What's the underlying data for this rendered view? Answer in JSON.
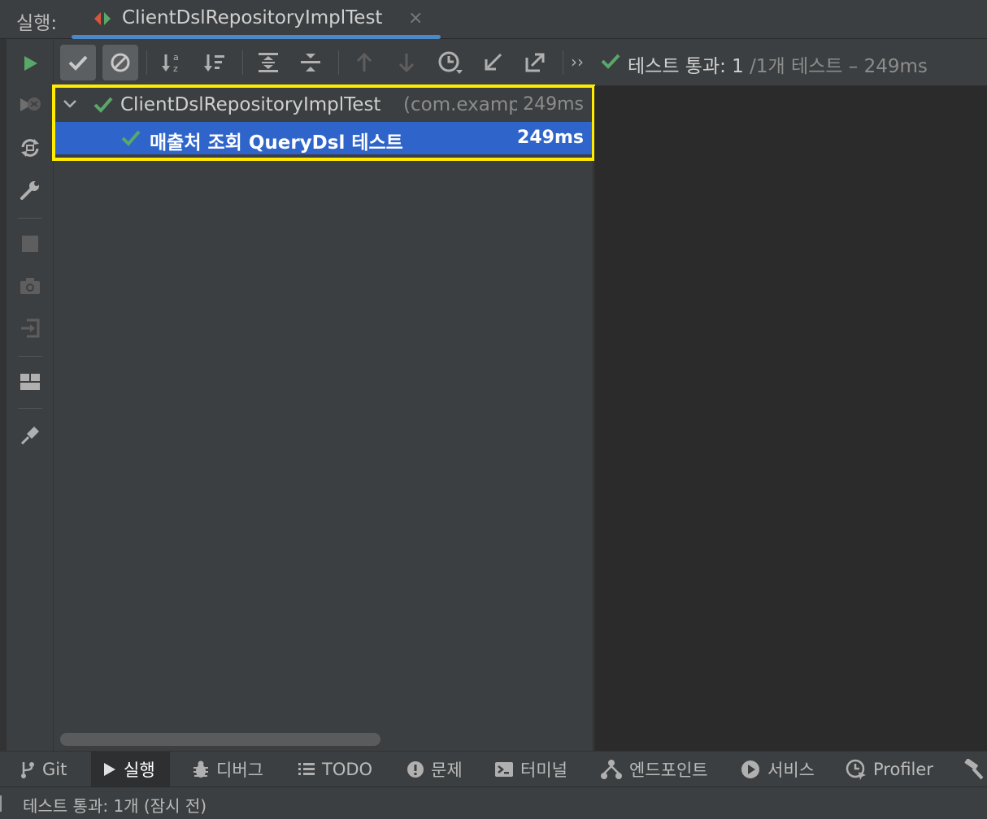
{
  "header": {
    "run_label": "실행:",
    "tab_title": "ClientDslRepositoryImplTest",
    "tab_close": "×"
  },
  "left_toolbar": {
    "icons": [
      "run-icon",
      "rerun-failed-icon",
      "toggle-autotest-icon",
      "settings-wrench-icon",
      "stop-icon",
      "screenshot-camera-icon",
      "export-login-icon",
      "layout-icon",
      "pin-icon"
    ]
  },
  "test_toolbar": {
    "status_main": "테스트 통과: 1",
    "status_rest": " /1개 테스트 – 249ms",
    "overflow": "››"
  },
  "tree": {
    "root": {
      "name": "ClientDslRepositoryImplTest",
      "package": "(com.examp",
      "time": "249ms"
    },
    "child": {
      "name": "매출처 조회 QueryDsl 테스트",
      "time": "249ms"
    }
  },
  "bottom_tabs": [
    {
      "label": "Git",
      "icon": "git-branch-icon"
    },
    {
      "label": "실행",
      "icon": "run-icon"
    },
    {
      "label": "디버그",
      "icon": "bug-icon"
    },
    {
      "label": "TODO",
      "icon": "list-icon"
    },
    {
      "label": "문제",
      "icon": "problems-icon"
    },
    {
      "label": "터미널",
      "icon": "terminal-icon"
    },
    {
      "label": "엔드포인트",
      "icon": "endpoints-icon"
    },
    {
      "label": "서비스",
      "icon": "services-icon"
    },
    {
      "label": "Profiler",
      "icon": "profiler-icon"
    }
  ],
  "status_bar": {
    "message": "테스트 통과: 1개 (잠시 전)"
  },
  "colors": {
    "accent": "#4a88c7",
    "selection": "#2f65ca",
    "pass_green": "#59a869",
    "highlight": "#ffec00"
  }
}
